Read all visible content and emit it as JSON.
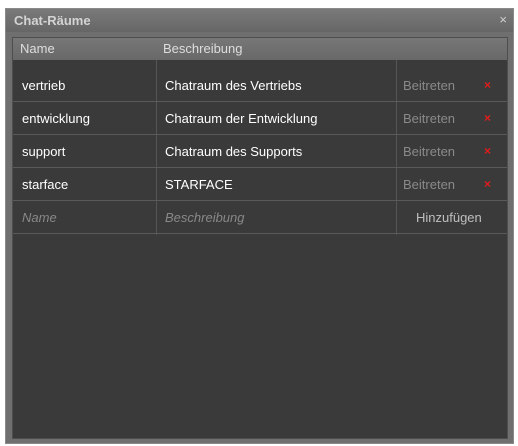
{
  "window": {
    "title": "Chat-Räume",
    "close_glyph": "×"
  },
  "columns": [
    "Name",
    "Beschreibung",
    ""
  ],
  "rooms": [
    {
      "name": "vertrieb",
      "description": "Chatraum des Vertriebs",
      "join_label": "Beitreten",
      "delete_glyph": "×"
    },
    {
      "name": "entwicklung",
      "description": "Chatraum der Entwicklung",
      "join_label": "Beitreten",
      "delete_glyph": "×"
    },
    {
      "name": "support",
      "description": "Chatraum des Supports",
      "join_label": "Beitreten",
      "delete_glyph": "×"
    },
    {
      "name": "starface",
      "description": "STARFACE",
      "join_label": "Beitreten",
      "delete_glyph": "×"
    }
  ],
  "new_room": {
    "name_placeholder": "Name",
    "description_placeholder": "Beschreibung",
    "add_label": "Hinzufügen"
  },
  "colors": {
    "delete_icon": "#e21c1c",
    "panel_background": "#3a3a3a",
    "window_frame": "#6f6f6f"
  }
}
